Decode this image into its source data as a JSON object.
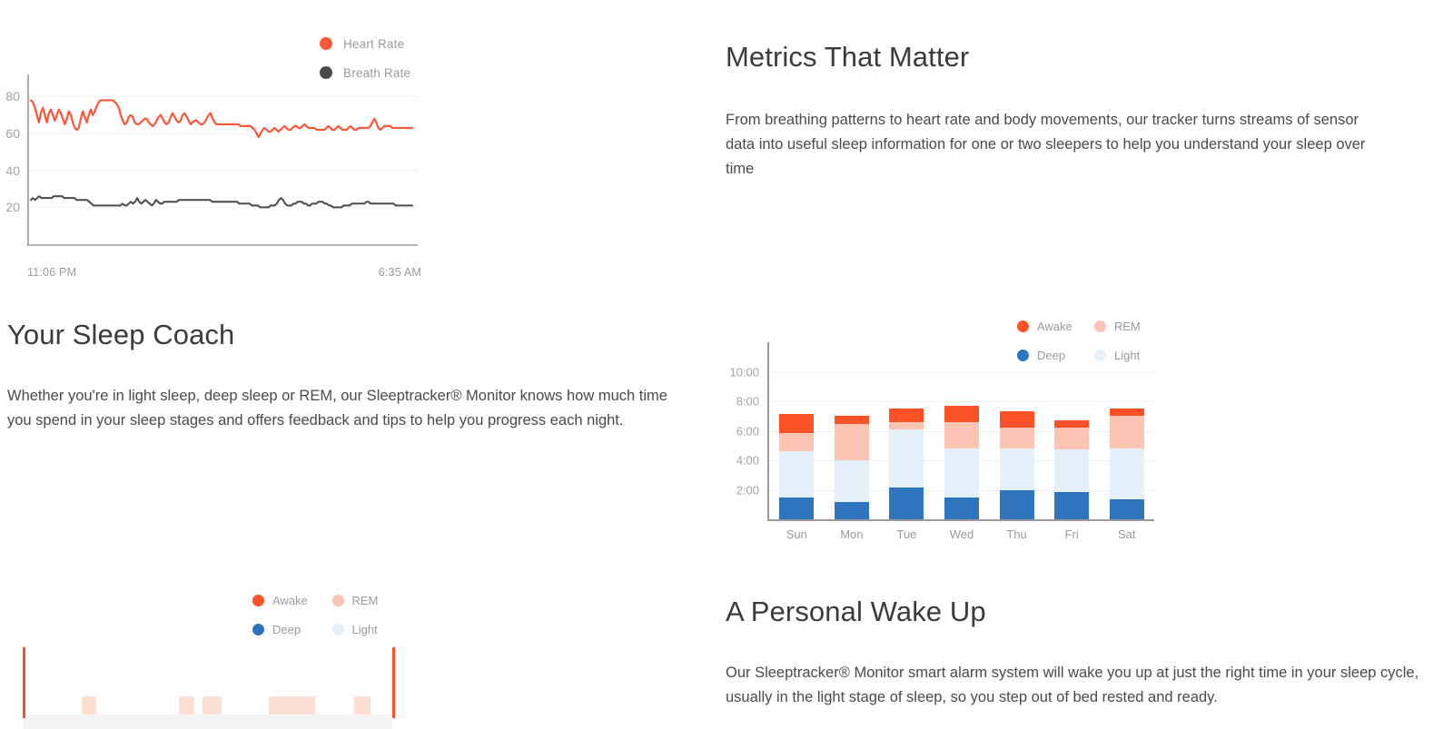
{
  "colors": {
    "awake": "#fa5226",
    "rem": "#fcc4b2",
    "deep": "#2e75bd",
    "light": "#e4f1fb",
    "heart_rate": "#f9573a",
    "breath_rate": "#4a4a4a",
    "text_heading": "#3b3b3d",
    "text_body": "#4a4a4c",
    "text_muted": "#9b9b9e",
    "gridline": "#f0f0f0",
    "axis": "#9a9a9c"
  },
  "metrics_section": {
    "title": "Metrics That Matter",
    "body": "From breathing patterns to heart rate and body movements, our tracker turns streams of sensor data into useful sleep information for one or two sleepers to help you understand your sleep over time"
  },
  "coach_section": {
    "title": "Your Sleep Coach",
    "body": "Whether you're in light sleep, deep sleep or REM, our Sleeptracker® Monitor knows how much time you spend in your sleep stages and offers feedback and tips to help you progress each night."
  },
  "wakeup_section": {
    "title": "A Personal Wake Up",
    "body": "Our Sleeptracker® Monitor smart alarm system will wake you up at just the right time in your sleep cycle, usually in the light stage of sleep, so you step out of bed rested and ready."
  },
  "chart_data": [
    {
      "id": "vitals_line_chart",
      "type": "line",
      "title": "",
      "xlabel": "",
      "ylabel": "",
      "ylim": [
        0,
        92
      ],
      "yticks": [
        20,
        40,
        60,
        80
      ],
      "ytick_labels": [
        "20",
        "40",
        "60",
        "80"
      ],
      "grid": true,
      "legend_position": "top-right",
      "x_start_label": "11:06 PM",
      "x_end_label": "6:35 AM",
      "series": [
        {
          "name": "Heart Rate",
          "color": "#f9573a",
          "values": [
            78,
            77,
            74,
            70,
            66,
            71,
            74,
            70,
            66,
            71,
            73,
            70,
            67,
            70,
            73,
            71,
            68,
            65,
            68,
            72,
            70,
            66,
            63,
            62,
            63,
            68,
            72,
            69,
            66,
            70,
            73,
            70,
            72,
            75,
            77,
            78,
            78,
            78,
            78,
            78,
            78,
            78,
            77,
            76,
            74,
            70,
            67,
            65,
            66,
            69,
            70,
            69,
            66,
            65,
            65,
            66,
            67,
            68,
            68,
            66,
            65,
            64,
            65,
            67,
            69,
            70,
            68,
            66,
            65,
            66,
            69,
            71,
            69,
            67,
            66,
            67,
            70,
            71,
            69,
            67,
            65,
            66,
            67,
            67,
            66,
            65,
            65,
            66,
            68,
            70,
            71,
            68,
            66,
            65,
            65,
            65,
            65,
            65,
            65,
            65,
            65,
            65,
            65,
            65,
            65,
            64,
            64,
            64,
            64,
            64,
            64,
            63,
            62,
            60,
            58,
            60,
            62,
            63,
            62,
            61,
            61,
            62,
            63,
            62,
            61,
            62,
            63,
            64,
            63,
            62,
            62,
            63,
            64,
            64,
            63,
            63,
            64,
            65,
            64,
            63,
            63,
            63,
            63,
            62,
            62,
            62,
            62,
            62,
            63,
            64,
            63,
            62,
            62,
            63,
            64,
            63,
            62,
            62,
            62,
            63,
            64,
            63,
            62,
            62,
            63,
            63,
            63,
            63,
            63,
            63,
            64,
            66,
            68,
            66,
            63,
            62,
            63,
            64,
            64,
            64,
            64,
            63,
            63,
            63,
            63,
            63,
            63,
            63,
            63,
            63,
            63,
            63
          ]
        },
        {
          "name": "Breath Rate",
          "color": "#4a4a4a",
          "values": [
            24,
            25,
            24,
            25,
            26,
            25,
            25,
            25,
            25,
            25,
            25,
            26,
            26,
            26,
            26,
            26,
            25,
            25,
            25,
            25,
            25,
            25,
            24,
            24,
            24,
            24,
            24,
            24,
            23,
            22,
            21,
            21,
            21,
            21,
            21,
            21,
            21,
            21,
            21,
            21,
            21,
            21,
            21,
            21,
            22,
            21,
            21,
            22,
            23,
            22,
            23,
            25,
            23,
            22,
            23,
            24,
            23,
            22,
            21,
            22,
            24,
            23,
            22,
            22,
            23,
            23,
            23,
            23,
            23,
            23,
            23,
            24,
            24,
            24,
            24,
            24,
            24,
            24,
            24,
            24,
            24,
            24,
            24,
            24,
            24,
            24,
            24,
            23,
            23,
            23,
            23,
            23,
            23,
            23,
            23,
            23,
            23,
            23,
            23,
            23,
            22,
            22,
            22,
            22,
            22,
            22,
            21,
            21,
            21,
            21,
            20,
            20,
            20,
            20,
            20,
            21,
            21,
            21,
            22,
            24,
            25,
            24,
            22,
            21,
            21,
            21,
            22,
            22,
            23,
            23,
            23,
            22,
            22,
            21,
            21,
            22,
            22,
            22,
            23,
            23,
            23,
            22,
            22,
            21,
            21,
            20,
            20,
            20,
            20,
            20,
            21,
            21,
            21,
            21,
            22,
            22,
            22,
            22,
            22,
            22,
            22,
            23,
            23,
            22,
            22,
            22,
            22,
            22,
            22,
            22,
            22,
            22,
            22,
            22,
            22,
            21,
            21,
            21,
            21,
            21,
            21,
            21,
            21,
            21
          ]
        }
      ]
    },
    {
      "id": "weekly_sleep_stages_chart",
      "type": "bar",
      "stacked": true,
      "title": "",
      "xlabel": "",
      "ylabel": "",
      "categories": [
        "Sun",
        "Mon",
        "Tue",
        "Wed",
        "Thu",
        "Fri",
        "Sat"
      ],
      "yticks": [
        2,
        4,
        6,
        8,
        10
      ],
      "ytick_labels": [
        "2:00",
        "4:00",
        "6:00",
        "8:00",
        "10:00"
      ],
      "ylim": [
        0,
        11.4
      ],
      "grid": true,
      "legend_position": "top-right",
      "series": [
        {
          "name": "Deep",
          "color": "#2e75bd",
          "values": [
            1.45,
            1.2,
            2.15,
            1.5,
            2.0,
            1.85,
            1.35
          ]
        },
        {
          "name": "Light",
          "color": "#e4f1fb",
          "values": [
            3.2,
            2.8,
            3.95,
            3.3,
            2.8,
            2.9,
            3.45
          ]
        },
        {
          "name": "REM",
          "color": "#fcc4b2",
          "values": [
            1.2,
            2.45,
            0.5,
            1.8,
            1.4,
            1.5,
            2.25
          ]
        },
        {
          "name": "Awake",
          "color": "#fa5226",
          "values": [
            1.3,
            0.6,
            0.9,
            1.1,
            1.15,
            0.5,
            0.5
          ]
        }
      ]
    },
    {
      "id": "nightly_hypnogram_chart",
      "type": "bar",
      "title": "",
      "xlabel": "",
      "ylabel": "",
      "legend_position": "top-right",
      "note": "cropped at bottom of viewport",
      "series": [
        {
          "name": "Awake",
          "color": "#fa5226"
        },
        {
          "name": "REM",
          "color": "#fcc4b2"
        },
        {
          "name": "Deep",
          "color": "#2e75bd"
        },
        {
          "name": "Light",
          "color": "#e4f1fb"
        }
      ],
      "markers": [
        {
          "name": "sleep-start-marker",
          "x_pct": 5.3
        },
        {
          "name": "sleep-end-marker",
          "x_pct": 91.9
        }
      ],
      "rem_bands": [
        {
          "x_pct": 19.1,
          "w_pct": 3.4
        },
        {
          "x_pct": 41.9,
          "w_pct": 3.6
        },
        {
          "x_pct": 47.5,
          "w_pct": 4.4
        },
        {
          "x_pct": 63.0,
          "w_pct": 10.8
        },
        {
          "x_pct": 82.9,
          "w_pct": 4.0
        }
      ]
    }
  ]
}
